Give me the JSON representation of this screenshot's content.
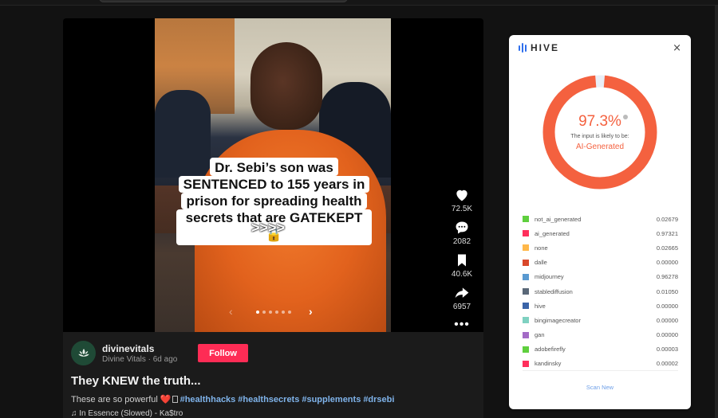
{
  "post": {
    "caption_lines": [
      "Dr. Sebi’s son was",
      "SENTENCED to 155 years in",
      "prison for spreading health",
      "secrets that are GATEKEPT 🔒"
    ],
    "overlay_arrows": ">>>>",
    "carousel": {
      "prev": "‹",
      "next": "›",
      "total_slides": 6,
      "active_index": 0
    },
    "actions": {
      "likes": "72.5K",
      "comments": "2082",
      "saves": "40.6K",
      "shares": "6957",
      "more": "•••"
    },
    "author": {
      "username": "divinevitals",
      "display_name": "Divine Vitals",
      "separator": " · ",
      "posted": "6d ago",
      "follow_label": "Follow"
    },
    "title": "They KNEW the truth...",
    "description": {
      "text": "These are so powerful ",
      "emoji": "❤️",
      "hashtags": [
        "#healthhacks",
        "#healthsecrets",
        "#supplements",
        "#drsebi"
      ]
    },
    "music": {
      "icon": "♫",
      "track": "In Essence (Slowed) - Ka$tro"
    }
  },
  "hive_panel": {
    "brand": "HIVE",
    "close_label": "×",
    "score": {
      "value_percent": 97.3,
      "display": "97.3%"
    },
    "likely_text": "The input is likely to be:",
    "verdict": "AI-Generated",
    "accent_color": "#f4613f",
    "track_color": "#e9eef6",
    "classes": [
      {
        "name": "not_ai_generated",
        "value": "0.02679",
        "color": "#5fcf3e"
      },
      {
        "name": "ai_generated",
        "value": "0.97321",
        "color": "#ff2f5c"
      },
      {
        "name": "none",
        "value": "0.02665",
        "color": "#ffb84a"
      },
      {
        "name": "dalle",
        "value": "0.00000",
        "color": "#d9482b"
      },
      {
        "name": "midjourney",
        "value": "0.96278",
        "color": "#5a9ad1"
      },
      {
        "name": "stablediffusion",
        "value": "0.01050",
        "color": "#5a6878"
      },
      {
        "name": "hive",
        "value": "0.00000",
        "color": "#3b64a8"
      },
      {
        "name": "bingimagecreator",
        "value": "0.00000",
        "color": "#7fd1c1"
      },
      {
        "name": "gan",
        "value": "0.00000",
        "color": "#a36bc6"
      },
      {
        "name": "adobefirefly",
        "value": "0.00003",
        "color": "#5fcf3e"
      },
      {
        "name": "kandinsky",
        "value": "0.00002",
        "color": "#ff2f5c"
      }
    ],
    "scan_new_label": "Scan New"
  }
}
